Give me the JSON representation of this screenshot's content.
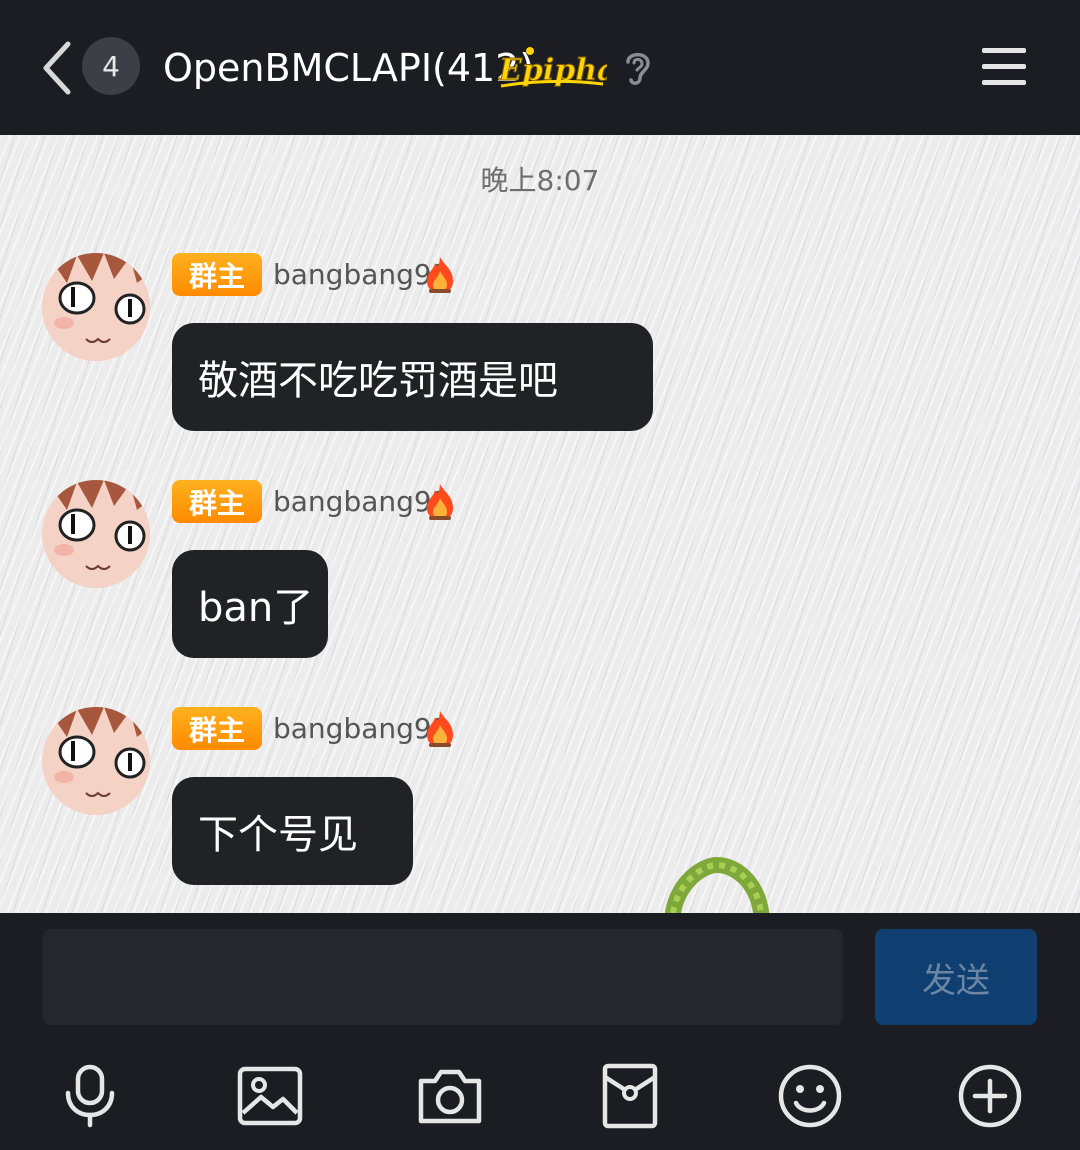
{
  "header": {
    "unread_count": "4",
    "title": "OpenBMCLAPI(412)",
    "brand_logo_text": "Epiphany"
  },
  "chat": {
    "timestamp": "晚上8:07",
    "messages": [
      {
        "badge": "群主",
        "sender": "bangbang93",
        "text": "敬酒不吃吃罚酒是吧"
      },
      {
        "badge": "群主",
        "sender": "bangbang93",
        "text": "ban了"
      },
      {
        "badge": "群主",
        "sender": "bangbang93",
        "text": "下个号见"
      }
    ]
  },
  "composer": {
    "input_value": "",
    "send_label": "发送"
  },
  "toolbar": {
    "icons": [
      "microphone-icon",
      "image-icon",
      "camera-icon",
      "red-packet-icon",
      "emoji-icon",
      "plus-icon"
    ]
  },
  "colors": {
    "header_bg": "#1b1d22",
    "bubble_bg": "#202226",
    "badge_orange": "#ff9a0a",
    "send_button_bg": "#0e3f70"
  }
}
